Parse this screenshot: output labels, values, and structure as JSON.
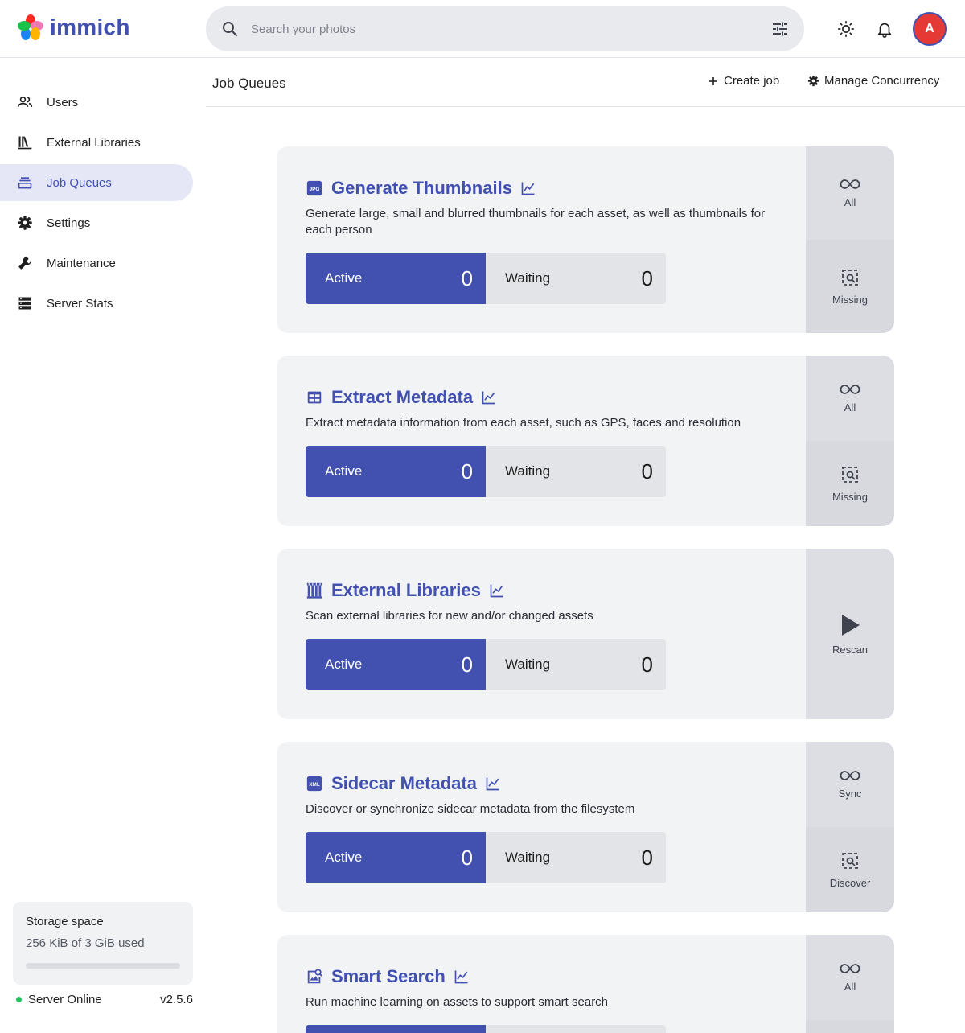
{
  "app": {
    "name": "immich"
  },
  "search": {
    "placeholder": "Search your photos"
  },
  "user": {
    "initial": "A"
  },
  "sidebar": {
    "items": [
      {
        "label": "Users",
        "icon": "users-icon"
      },
      {
        "label": "External Libraries",
        "icon": "library-icon"
      },
      {
        "label": "Job Queues",
        "icon": "queue-icon",
        "active": true
      },
      {
        "label": "Settings",
        "icon": "gear-icon"
      },
      {
        "label": "Maintenance",
        "icon": "wrench-icon"
      },
      {
        "label": "Server Stats",
        "icon": "server-icon"
      }
    ],
    "storage": {
      "title": "Storage space",
      "usage": "256 KiB of 3 GiB used",
      "fraction": 0.0001
    },
    "server": {
      "status": "Server Online",
      "version": "v2.5.6"
    }
  },
  "page": {
    "title": "Job Queues",
    "create_job": "Create job",
    "manage_concurrency": "Manage Concurrency"
  },
  "jobs": [
    {
      "name": "Generate Thumbnails",
      "icon": "jpg-icon",
      "description": "Generate large, small and blurred thumbnails for each asset, as well as thumbnails for each person",
      "active_label": "Active",
      "active": "0",
      "waiting_label": "Waiting",
      "waiting": "0",
      "actions": [
        {
          "label": "All",
          "icon": "infinity-icon"
        },
        {
          "label": "Missing",
          "icon": "image-search-icon"
        }
      ]
    },
    {
      "name": "Extract Metadata",
      "icon": "table-icon",
      "description": "Extract metadata information from each asset, such as GPS, faces and resolution",
      "active_label": "Active",
      "active": "0",
      "waiting_label": "Waiting",
      "waiting": "0",
      "actions": [
        {
          "label": "All",
          "icon": "infinity-icon"
        },
        {
          "label": "Missing",
          "icon": "image-search-icon"
        }
      ]
    },
    {
      "name": "External Libraries",
      "icon": "library-columns-icon",
      "description": "Scan external libraries for new and/or changed assets",
      "active_label": "Active",
      "active": "0",
      "waiting_label": "Waiting",
      "waiting": "0",
      "actions": [
        {
          "label": "Rescan",
          "icon": "play-icon"
        }
      ]
    },
    {
      "name": "Sidecar Metadata",
      "icon": "xml-icon",
      "description": "Discover or synchronize sidecar metadata from the filesystem",
      "active_label": "Active",
      "active": "0",
      "waiting_label": "Waiting",
      "waiting": "0",
      "actions": [
        {
          "label": "Sync",
          "icon": "infinity-icon"
        },
        {
          "label": "Discover",
          "icon": "image-search-icon"
        }
      ]
    },
    {
      "name": "Smart Search",
      "icon": "image-search-icon",
      "description": "Run machine learning on assets to support smart search",
      "actions": [
        {
          "label": "All",
          "icon": "infinity-icon"
        }
      ]
    }
  ],
  "colors": {
    "accent": "#4250af",
    "card": "#f2f3f5",
    "action_panel": "#dcdee3",
    "status_online": "#22c55e"
  }
}
